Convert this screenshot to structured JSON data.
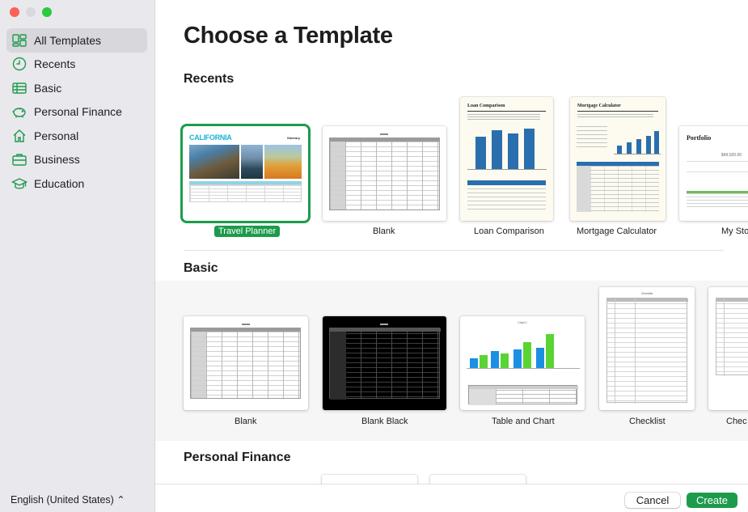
{
  "sidebar": {
    "items": [
      {
        "label": "All Templates",
        "icon": "templates-grid-icon"
      },
      {
        "label": "Recents",
        "icon": "clock-icon"
      },
      {
        "label": "Basic",
        "icon": "table-icon"
      },
      {
        "label": "Personal Finance",
        "icon": "piggy-bank-icon"
      },
      {
        "label": "Personal",
        "icon": "house-icon"
      },
      {
        "label": "Business",
        "icon": "briefcase-icon"
      },
      {
        "label": "Education",
        "icon": "graduation-cap-icon"
      }
    ],
    "language": "English (United States) ⌃"
  },
  "main": {
    "title": "Choose a Template",
    "recents_title": "Recents",
    "basic_title": "Basic",
    "personal_finance_title": "Personal Finance",
    "recents": [
      {
        "label": "Travel Planner"
      },
      {
        "label": "Blank"
      },
      {
        "label": "Loan Comparison"
      },
      {
        "label": "Mortgage Calculator"
      },
      {
        "label": "My Sto"
      }
    ],
    "basic": [
      {
        "label": "Blank"
      },
      {
        "label": "Blank Black"
      },
      {
        "label": "Table and Chart"
      },
      {
        "label": "Checklist"
      },
      {
        "label": "Chec"
      }
    ],
    "thumbs": {
      "california": "CALIFORNIA",
      "itinerary": "Itinerary",
      "loan_title": "Loan Comparison",
      "mortgage_title": "Mortgage Calculator",
      "portfolio_title": "Portfolio",
      "portfolio_value": "$49,020.00",
      "chart_title": "Chart 1",
      "checklist_title": "Checklist"
    }
  },
  "buttons": {
    "cancel": "Cancel",
    "create": "Create"
  },
  "colors": {
    "accent": "#1d9b4c",
    "sidebar_bg": "#e9e8ec",
    "chart_blue": "#1a8fe3",
    "chart_green": "#5ad434",
    "loan_blue": "#2a6fad"
  }
}
